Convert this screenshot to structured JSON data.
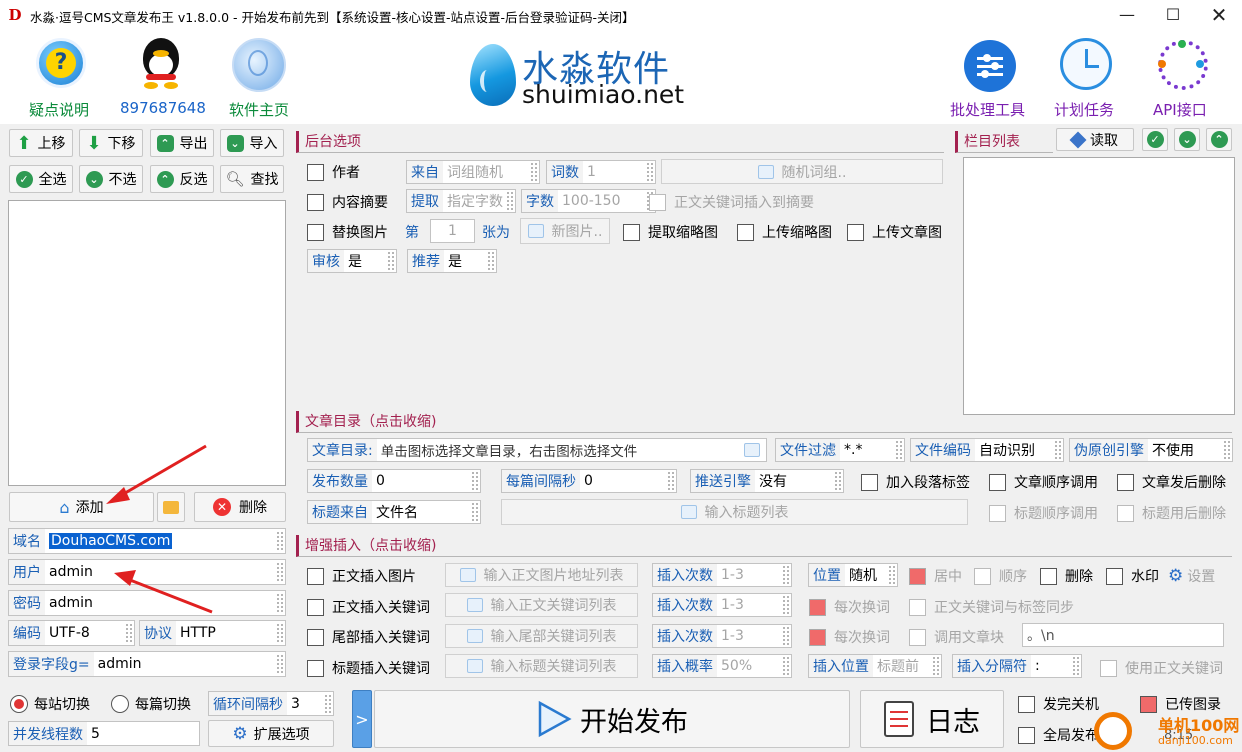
{
  "window": {
    "title": "水淼·逗号CMS文章发布王 v1.8.0.0 - 开始发布前先到【系统设置-核心设置-站点设置-后台登录验证码-关闭】"
  },
  "banner": {
    "help": "疑点说明",
    "qq": "897687648",
    "home": "软件主页",
    "brand_cn": "水淼软件",
    "brand_en": "shuimiao.net",
    "batch": "批处理工具",
    "schedule": "计划任务",
    "api": "API接口"
  },
  "toolbar": {
    "up": "上移",
    "down": "下移",
    "export": "导出",
    "import": "导入",
    "select_all": "全选",
    "select_none": "不选",
    "invert": "反选",
    "find": "查找"
  },
  "site": {
    "add": "添加",
    "delete": "删除",
    "domain_label": "域名",
    "domain": "DouhaoCMS.com",
    "user_label": "用户",
    "user": "admin",
    "pass_label": "密码",
    "pass": "admin",
    "encoding_label": "编码",
    "encoding": "UTF-8",
    "protocol_label": "协议",
    "protocol": "HTTP",
    "login_field_label": "登录字段g=",
    "login_field": "admin"
  },
  "backend": {
    "title": "后台选项",
    "author": "作者",
    "source_label": "来自",
    "source": "词组随机",
    "count_label": "词数",
    "count": "1",
    "random_words": "随机词组..",
    "summary": "内容摘要",
    "extract_label": "提取",
    "extract": "指定字数",
    "chars_label": "字数",
    "chars": "100-150",
    "kw_to_summary": "正文关键词插入到摘要",
    "replace_img": "替换图片",
    "nth": "第",
    "nth_value": "1",
    "nth_unit": "张为",
    "new_img": "新图片..",
    "thumb_extract": "提取缩略图",
    "thumb_upload": "上传缩略图",
    "upload_img": "上传文章图",
    "review_label": "审核",
    "review": "是",
    "recommend_label": "推荐",
    "recommend": "是"
  },
  "columns": {
    "title": "栏目列表",
    "read": "读取"
  },
  "articles": {
    "title": "文章目录（点击收缩)",
    "dir_label": "文章目录:",
    "dir_hint": "单击图标选择文章目录，右击图标选择文件",
    "filter_label": "文件过滤",
    "filter": "*.*",
    "enc_label": "文件编码",
    "enc": "自动识别",
    "pseudo_label": "伪原创引擎",
    "pseudo": "不使用",
    "pub_count_label": "发布数量",
    "pub_count": "0",
    "interval_label": "每篇间隔秒",
    "interval": "0",
    "push_label": "推送引擎",
    "push": "没有",
    "para_tag": "加入段落标签",
    "seq_call": "文章顺序调用",
    "del_after": "文章发后删除",
    "title_src_label": "标题来自",
    "title_src": "文件名",
    "title_list": "输入标题列表",
    "title_seq": "标题顺序调用",
    "title_del": "标题用后删除"
  },
  "enhance": {
    "title": "增强插入（点击收缩)",
    "img_insert": "正文插入图片",
    "img_list": "输入正文图片地址列表",
    "kw_insert": "正文插入关键词",
    "kw_list": "输入正文关键词列表",
    "tail_insert": "尾部插入关键词",
    "tail_list": "输入尾部关键词列表",
    "title_insert": "标题插入关键词",
    "title_list": "输入标题关键词列表",
    "times_label": "插入次数",
    "times": "1-3",
    "prob_label": "插入概率",
    "prob": "50%",
    "pos_label": "位置",
    "pos": "随机",
    "center": "居中",
    "order": "顺序",
    "remove": "删除",
    "watermark": "水印",
    "settings": "设置",
    "each_change": "每次换词",
    "kw_tag_sync": "正文关键词与标签同步",
    "call_block": "调用文章块",
    "block_value": "。\\n",
    "ins_pos_label": "插入位置",
    "ins_pos": "标题前",
    "sep_label": "插入分隔符",
    "sep": ":",
    "use_kw": "使用正文关键词"
  },
  "bottom": {
    "per_site": "每站切换",
    "per_article": "每篇切换",
    "loop_label": "循环间隔秒",
    "loop": "3",
    "threads_label": "并发线程数",
    "threads": "5",
    "ext": "扩展选项",
    "expand": ">",
    "start": "开始发布",
    "log": "日志",
    "shutdown": "发完关机",
    "uploaded": "已传图录",
    "global_count": "全局发布数量",
    "time": "8:15"
  },
  "watermark_site": {
    "name": "单机100网",
    "url": "danji100.com"
  }
}
